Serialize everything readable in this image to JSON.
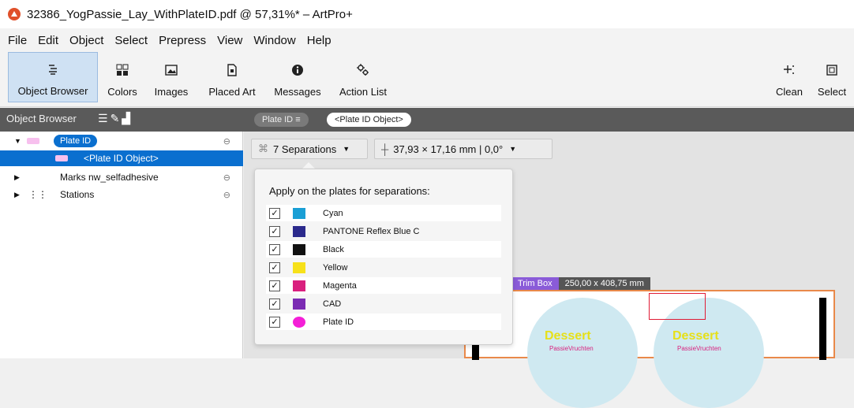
{
  "window": {
    "title": "32386_YogPassie_Lay_WithPlateID.pdf @ 57,31%* – ArtPro+"
  },
  "menu": [
    "File",
    "Edit",
    "Object",
    "Select",
    "Prepress",
    "View",
    "Window",
    "Help"
  ],
  "toolbar": {
    "object_browser": "Object Browser",
    "colors": "Colors",
    "images": "Images",
    "placed_art": "Placed Art",
    "messages": "Messages",
    "action_list": "Action List",
    "clean": "Clean",
    "select": "Select"
  },
  "panel": {
    "title": "Object Browser"
  },
  "breadcrumb": {
    "plate_id": "Plate ID",
    "plate_id_object": "<Plate ID Object>"
  },
  "tree": {
    "plate_id": "Plate ID",
    "plate_id_object": "<Plate ID Object>",
    "marks": "Marks nw_selfadhesive",
    "stations": "Stations"
  },
  "controls": {
    "separations": "7 Separations",
    "dimensions": "37,93 × 17,16 mm  |  0,0°"
  },
  "popup": {
    "heading": "Apply on the plates for separations:",
    "separations": [
      {
        "name": "Cyan",
        "color": "#1a9fd5",
        "checked": true
      },
      {
        "name": "PANTONE Reflex Blue C",
        "color": "#2b2a8c",
        "checked": true
      },
      {
        "name": "Black",
        "color": "#111111",
        "checked": true
      },
      {
        "name": "Yellow",
        "color": "#f7e11a",
        "checked": true
      },
      {
        "name": "Magenta",
        "color": "#d9207e",
        "checked": true
      },
      {
        "name": "CAD",
        "color": "#7b2bb3",
        "checked": true
      },
      {
        "name": "Plate ID",
        "color": "#f41fd7",
        "checked": true
      }
    ]
  },
  "canvas": {
    "trim_label": "Trim Box",
    "trim_size": "250,00 x 408,75 mm",
    "label_brand": "Dessert",
    "label_sub": "PassieVruchten"
  }
}
